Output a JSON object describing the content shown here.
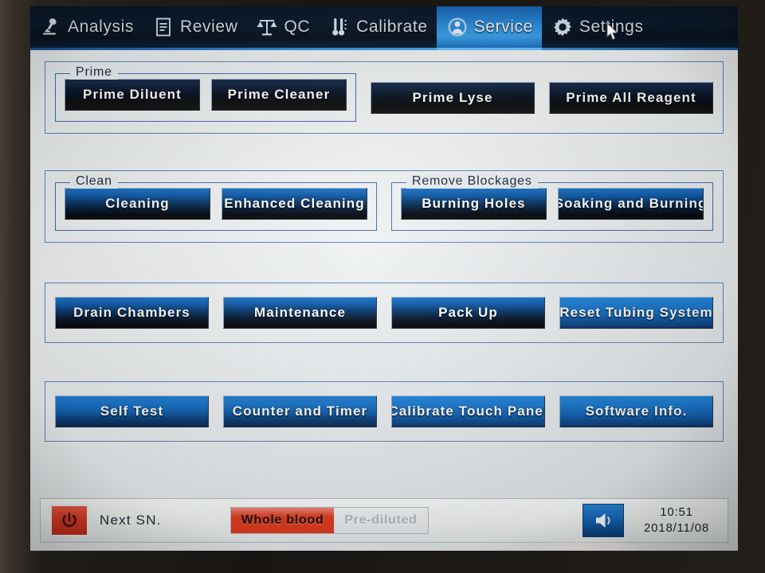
{
  "navbar": {
    "tabs": [
      {
        "label": "Analysis",
        "icon": "microscope-icon",
        "active": false
      },
      {
        "label": "Review",
        "icon": "document-icon",
        "active": false
      },
      {
        "label": "QC",
        "icon": "scales-icon",
        "active": false
      },
      {
        "label": "Calibrate",
        "icon": "thermometer-icon",
        "active": false
      },
      {
        "label": "Service",
        "icon": "person-icon",
        "active": true
      },
      {
        "label": "Settings",
        "icon": "gear-icon",
        "active": false
      }
    ],
    "active_tab": "Service",
    "accent_color": "#2a8ad8",
    "background_color": "#0b1b2e"
  },
  "main": {
    "sections": [
      {
        "legend": "Prime",
        "buttons": [
          {
            "label": "Prime Diluent"
          },
          {
            "label": "Prime Cleaner"
          }
        ]
      },
      {
        "legend": "",
        "buttons": [
          {
            "label": "Prime Lyse"
          },
          {
            "label": "Prime All Reagent"
          }
        ]
      },
      {
        "legend": "Clean",
        "buttons": [
          {
            "label": "Cleaning"
          },
          {
            "label": "Enhanced Cleaning"
          }
        ]
      },
      {
        "legend": "Remove Blockages",
        "buttons": [
          {
            "label": "Burning Holes"
          },
          {
            "label": "Soaking and Burning"
          }
        ]
      }
    ],
    "row3_buttons": [
      {
        "label": "Drain Chambers"
      },
      {
        "label": "Maintenance"
      },
      {
        "label": "Pack Up"
      },
      {
        "label": "Reset Tubing System"
      }
    ],
    "row4_buttons": [
      {
        "label": "Self Test"
      },
      {
        "label": "Counter and Timer"
      },
      {
        "label": "Calibrate Touch Panel"
      },
      {
        "label": "Software Info."
      }
    ]
  },
  "statusbar": {
    "power_icon": "power-icon",
    "next_sn_label": "Next SN.",
    "mode_segments": [
      {
        "label": "Whole blood",
        "active": true
      },
      {
        "label": "Pre-diluted",
        "active": false
      }
    ],
    "speaker_icon": "speaker-icon",
    "time": "10:51",
    "date": "2018/11/08",
    "active_mode_color": "#e23a1c",
    "power_color": "#dc3a24"
  }
}
